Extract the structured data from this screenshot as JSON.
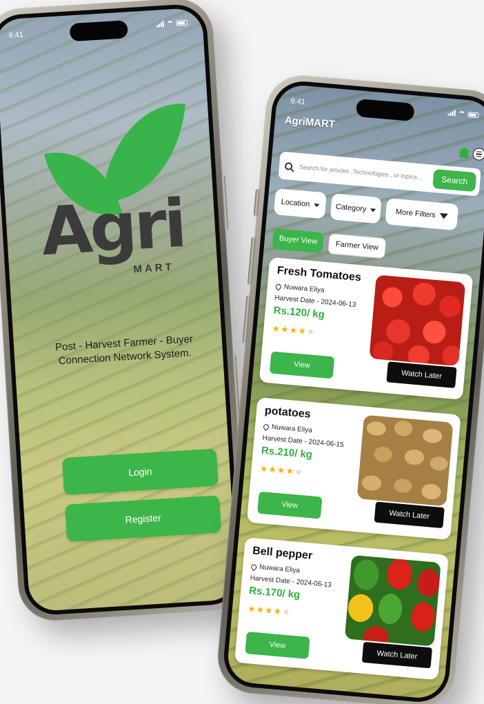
{
  "login_phone": {
    "status_time": "9:41",
    "logo_text": "Agri",
    "logo_subtext": "MART",
    "tagline": "Post - Harvest Farmer - Buyer Connection Network System.",
    "login_label": "Login",
    "register_label": "Register",
    "accent_color": "#3cb54a"
  },
  "app_phone": {
    "status_time": "9:41",
    "app_title": "AgriMART",
    "search": {
      "placeholder": "Search for articles ,Technologies , or topics...",
      "button_label": "Search"
    },
    "filters": {
      "location": "Location",
      "category": "Category",
      "more": "More Filters"
    },
    "views": {
      "buyer": "Buyer View",
      "farmer": "Farmer View",
      "active": "buyer"
    },
    "products": [
      {
        "name": "Fresh Tomatoes",
        "location": "Nuwara Eliya",
        "harvest": "Harvest Date - 2024-06-13",
        "price": "Rs.120/ kg",
        "rating": 3.5,
        "image": "tomatoes",
        "view_label": "View",
        "later_label": "Watch Later"
      },
      {
        "name": "potatoes",
        "location": "Nuwara Eliya",
        "harvest": "Harvest Date - 2024-06-15",
        "price": "Rs.210/ kg",
        "rating": 3.5,
        "image": "potatoes",
        "view_label": "View",
        "later_label": "Watch Later"
      },
      {
        "name": "Bell pepper",
        "location": "Nuwara Eliya",
        "harvest": "Harvest Date - 2024-06-13",
        "price": "Rs.170/ kg",
        "rating": 3.5,
        "image": "bell-peppers",
        "view_label": "View",
        "later_label": "Watch Later"
      }
    ]
  }
}
